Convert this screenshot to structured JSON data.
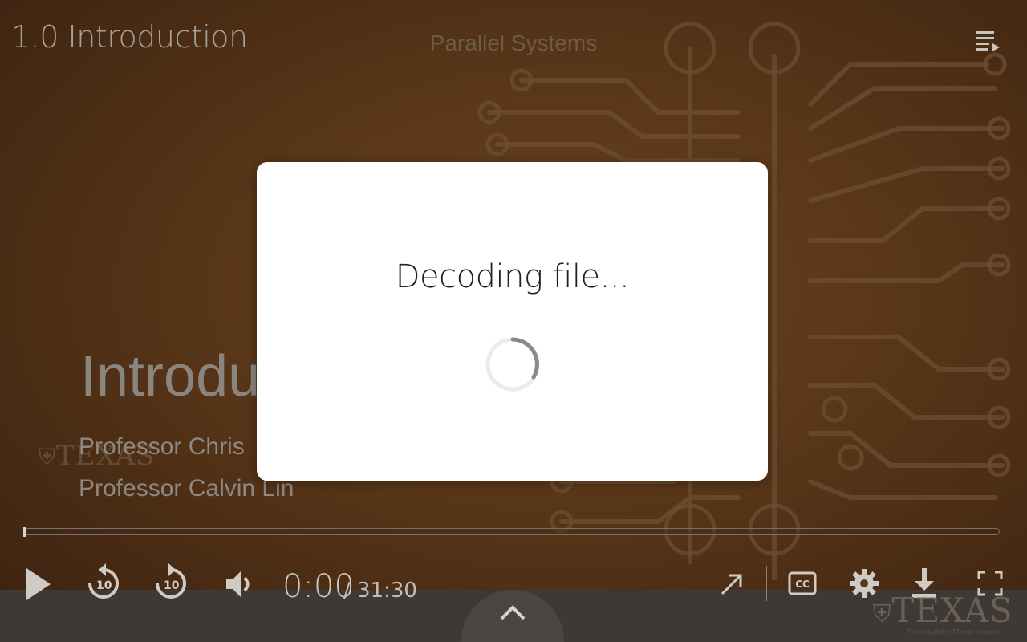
{
  "player": {
    "video_title": "1.0 Introduction",
    "course_title": "Parallel Systems",
    "playlist_icon": "playlist-icon"
  },
  "slide": {
    "title": "Introdu",
    "presenter_1": "Professor Chris",
    "presenter_2": "Professor Calvin Lin",
    "watermark": "TEXAS"
  },
  "dialog": {
    "message": "Decoding file...",
    "spinner_icon": "spinner-icon"
  },
  "controls": {
    "current_time": "0:00",
    "duration_text": "/ 31:30",
    "progress_fraction": 0.0,
    "skip_back_label": "10",
    "skip_forward_label": "10",
    "icons": [
      "play-icon",
      "rewind-10-icon",
      "forward-10-icon",
      "volume-icon",
      "popout-icon",
      "closed-captions-icon",
      "settings-icon",
      "download-icon",
      "fullscreen-icon",
      "chevron-up-icon"
    ]
  },
  "branding": {
    "logo_text": "TEXAS",
    "logo_subtitle": "The University of Texas at Austin"
  },
  "colors": {
    "background_brown": "#5a3719",
    "modal_background": "#ffffff",
    "control_icon": "#cfcac4",
    "control_bar_shade": "#3c3937"
  }
}
